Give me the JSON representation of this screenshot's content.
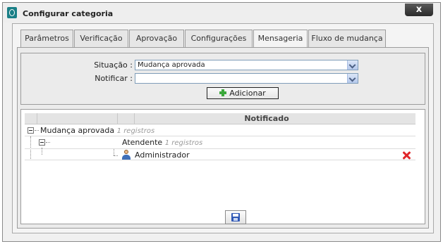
{
  "window": {
    "title": "Configurar categoria",
    "close_label": "x"
  },
  "tabs": [
    {
      "label": "Parâmetros",
      "active": false
    },
    {
      "label": "Verificação",
      "active": false
    },
    {
      "label": "Aprovação",
      "active": false
    },
    {
      "label": "Configurações",
      "active": false
    },
    {
      "label": "Mensageria",
      "active": true
    },
    {
      "label": "Fluxo de mudança",
      "active": false
    }
  ],
  "form": {
    "situacao_label": "Situação :",
    "situacao_value": "Mudança aprovada",
    "notificar_label": "Notificar :",
    "notificar_value": "",
    "add_button_label": "Adicionar"
  },
  "grid": {
    "header": "Notificado",
    "group": {
      "label": "Mudança aprovada",
      "count": "1 registros"
    },
    "subgroup": {
      "label": "Atendente",
      "count": "1 registros"
    },
    "rows": [
      {
        "name": "Administrador"
      }
    ]
  },
  "colors": {
    "accent": "#1a7f86",
    "delete": "#e0262a",
    "add": "#3ba83b",
    "save": "#2f58b5"
  },
  "icons": {
    "app": "app-logo-icon",
    "add": "plus-icon",
    "user": "user-icon",
    "delete": "delete-icon",
    "save": "save-icon",
    "toggle": "collapse-icon"
  }
}
